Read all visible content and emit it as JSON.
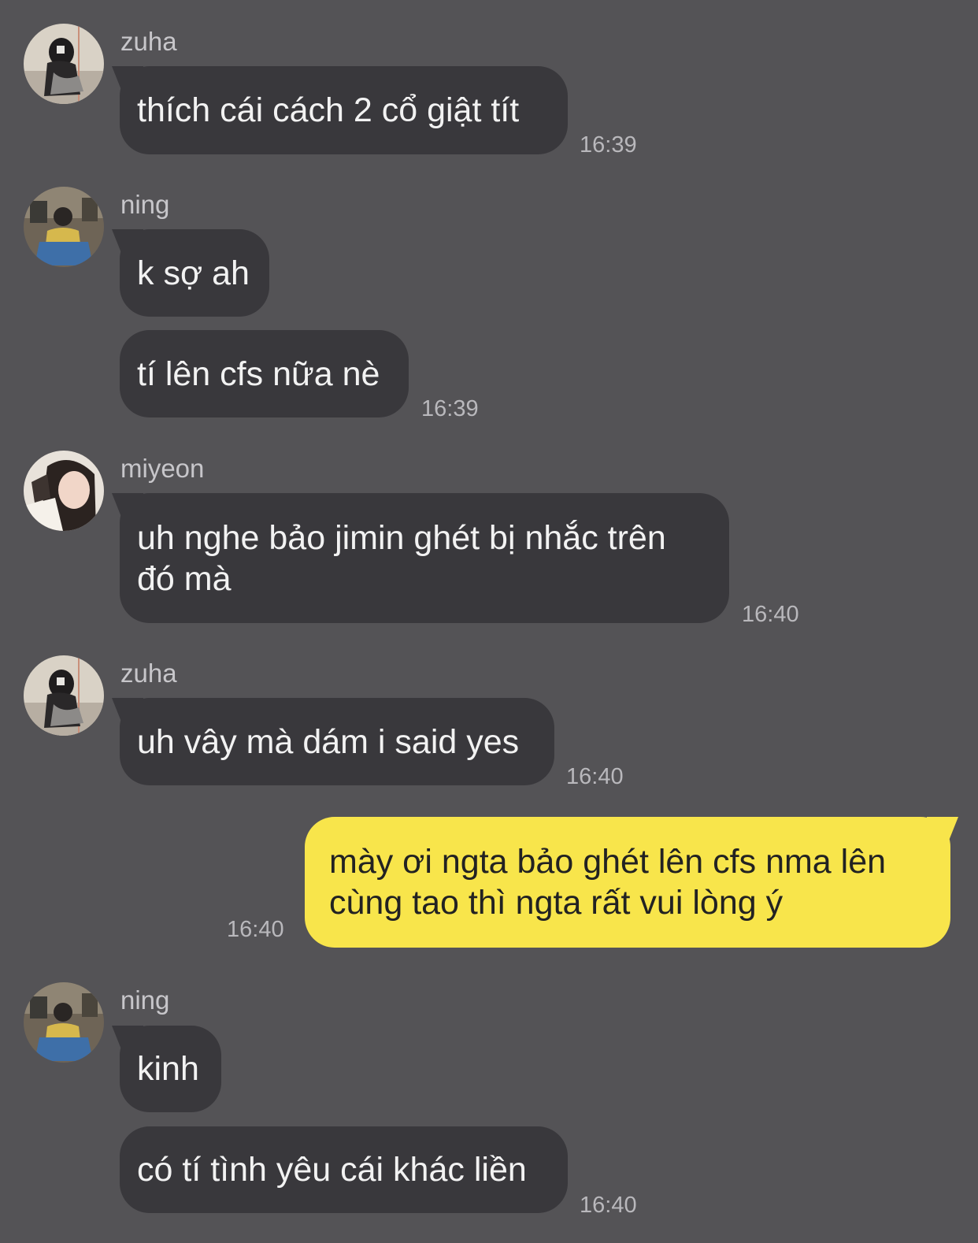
{
  "messages": [
    {
      "sender": "zuha",
      "text": "thích cái cách 2 cổ giật tít",
      "time": "16:39"
    },
    {
      "sender": "ning",
      "text": "k sợ ah"
    },
    {
      "text": "tí lên cfs nữa nè",
      "time": "16:39"
    },
    {
      "sender": "miyeon",
      "text": "uh nghe bảo jimin ghét bị nhắc trên đó mà",
      "time": "16:40"
    },
    {
      "sender": "zuha",
      "text": "uh vây mà dám i said yes",
      "time": "16:40"
    },
    {
      "sender": "me",
      "text": "mày ơi ngta bảo ghét lên cfs nma lên cùng tao thì ngta rất vui lòng ý",
      "time": "16:40"
    },
    {
      "sender": "ning",
      "text": "kinh"
    },
    {
      "text": "có tí tình yêu cái khác liền",
      "time": "16:40"
    }
  ],
  "senders": [
    "zuha",
    "ning",
    "miyeon",
    "zuha",
    "ning"
  ],
  "colors": {
    "background": "#545356",
    "incoming_bubble": "#39383c",
    "outgoing_bubble": "#f8e54b",
    "sender_name": "#c7c6ca",
    "timestamp": "#b9b8bc"
  }
}
